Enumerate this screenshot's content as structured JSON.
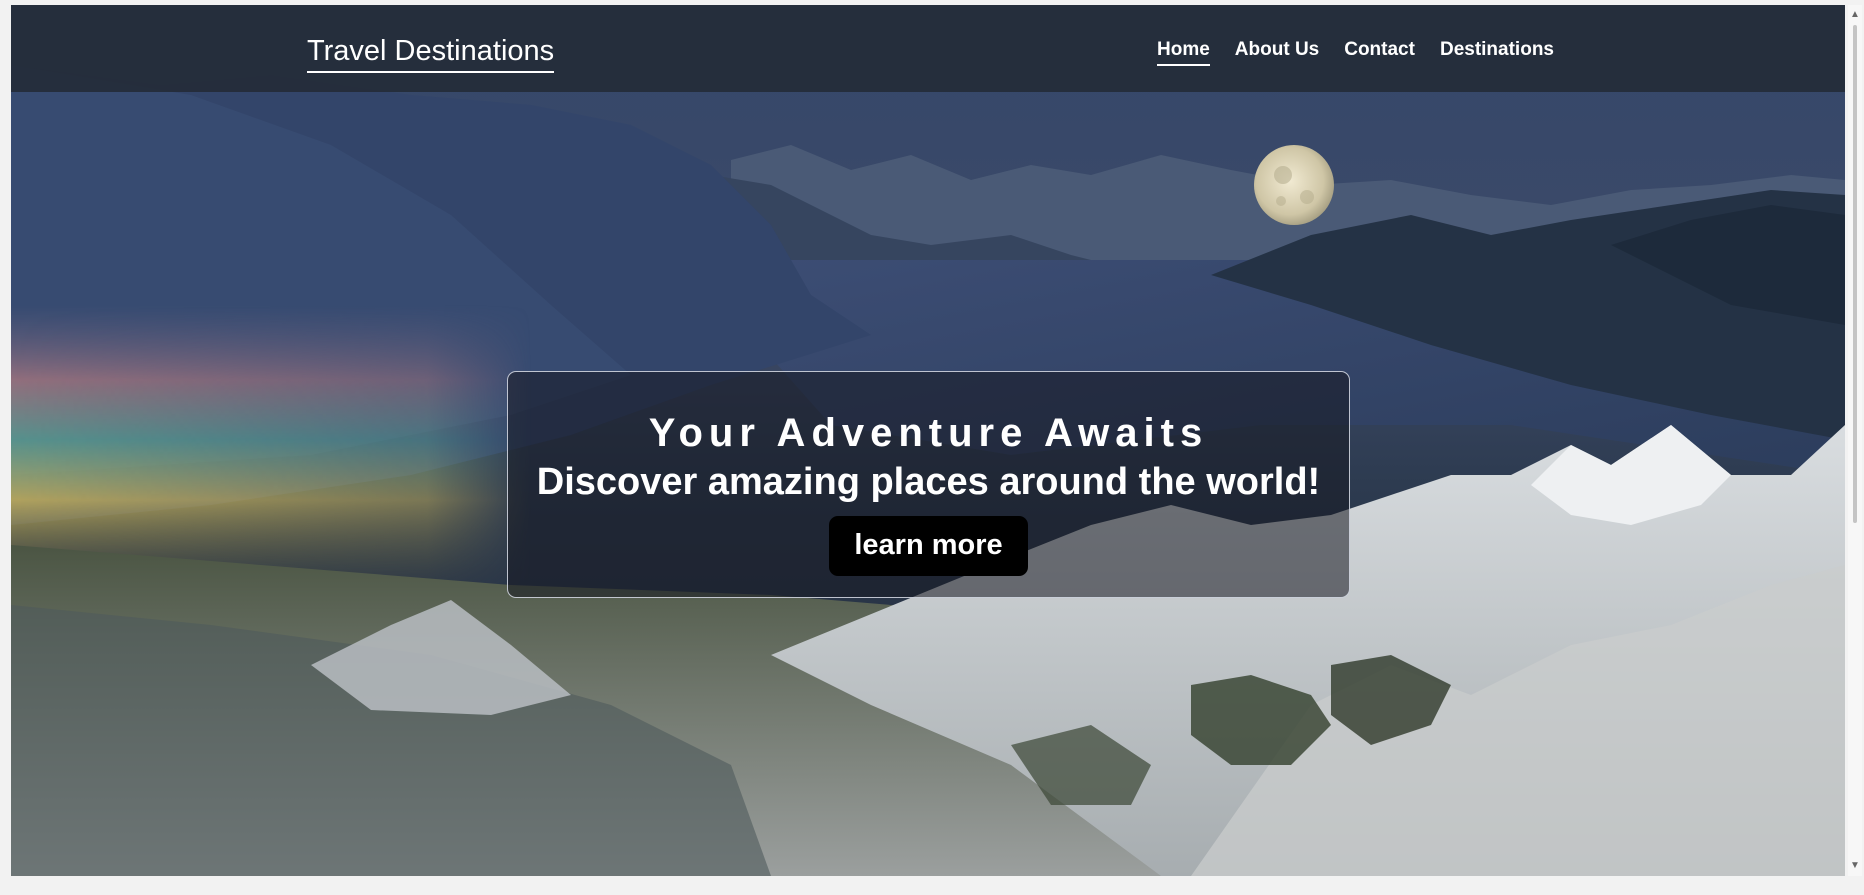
{
  "header": {
    "brand": "Travel Destinations",
    "nav": [
      {
        "label": "Home",
        "active": true
      },
      {
        "label": "About Us",
        "active": false
      },
      {
        "label": "Contact",
        "active": false
      },
      {
        "label": "Destinations",
        "active": false
      }
    ]
  },
  "hero": {
    "title": "Your Adventure Awaits",
    "subtitle": "Discover amazing places around the world!",
    "cta_label": "learn more"
  },
  "scrollbar": {
    "up_icon": "chevron-up-icon",
    "down_icon": "chevron-down-icon"
  },
  "colors": {
    "nav_background": "#232a34",
    "cta_background": "#000000",
    "text": "#ffffff"
  }
}
